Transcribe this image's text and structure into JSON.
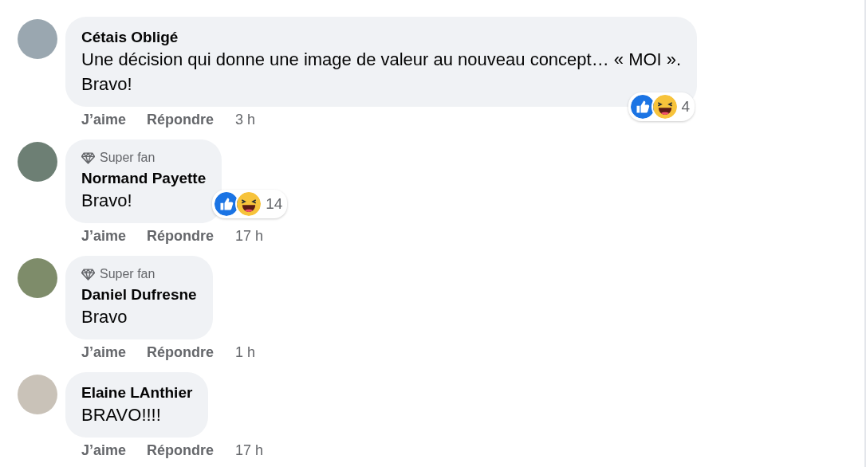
{
  "comments": [
    {
      "author": "Cétais Obligé",
      "text": "Une décision qui donne une image de valeur au nouveau concept… « MOI ».\nBravo!",
      "reactions": {
        "count": "4"
      },
      "actions": [
        "J’aime",
        "Répondre"
      ],
      "time": "3 h"
    },
    {
      "author": "Normand Payette",
      "badge": "Super fan",
      "text": "Bravo!",
      "reactions": {
        "count": "14"
      },
      "actions": [
        "J’aime",
        "Répondre"
      ],
      "time": "17 h"
    },
    {
      "author": "Daniel Dufresne",
      "badge": "Super fan",
      "text": "Bravo",
      "actions": [
        "J’aime",
        "Répondre"
      ],
      "time": "1 h"
    },
    {
      "author": "Elaine LAnthier",
      "text": "BRAVO!!!!",
      "actions": [
        "J’aime",
        "Répondre"
      ],
      "time": "17 h"
    }
  ]
}
